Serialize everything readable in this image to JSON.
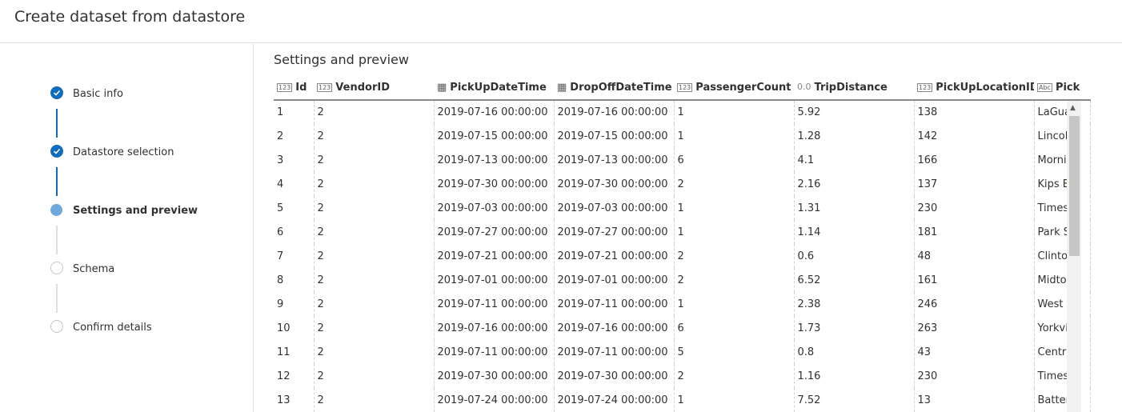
{
  "header": {
    "title": "Create dataset from datastore"
  },
  "steps": [
    {
      "label": "Basic info",
      "state": "done"
    },
    {
      "label": "Datastore selection",
      "state": "done"
    },
    {
      "label": "Settings and preview",
      "state": "current"
    },
    {
      "label": "Schema",
      "state": "todo"
    },
    {
      "label": "Confirm details",
      "state": "todo"
    }
  ],
  "main": {
    "title": "Settings and preview",
    "columns": [
      {
        "label": "Id",
        "type_icon": "123"
      },
      {
        "label": "VendorID",
        "type_icon": "123"
      },
      {
        "label": "PickUpDateTime",
        "type_icon": "calendar"
      },
      {
        "label": "DropOffDateTime",
        "type_icon": "calendar"
      },
      {
        "label": "PassengerCount",
        "type_icon": "123"
      },
      {
        "label": "TripDistance",
        "type_icon": "0.0"
      },
      {
        "label": "PickUpLocationID",
        "type_icon": "123"
      },
      {
        "label": "Pick",
        "type_icon": "Abc"
      }
    ],
    "rows": [
      [
        "1",
        "2",
        "2019-07-16 00:00:00",
        "2019-07-16 00:00:00",
        "1",
        "5.92",
        "138",
        "LaGua"
      ],
      [
        "2",
        "2",
        "2019-07-15 00:00:00",
        "2019-07-15 00:00:00",
        "1",
        "1.28",
        "142",
        "Lincol"
      ],
      [
        "3",
        "2",
        "2019-07-13 00:00:00",
        "2019-07-13 00:00:00",
        "6",
        "4.1",
        "166",
        "Morni"
      ],
      [
        "4",
        "2",
        "2019-07-30 00:00:00",
        "2019-07-30 00:00:00",
        "2",
        "2.16",
        "137",
        "Kips B"
      ],
      [
        "5",
        "2",
        "2019-07-03 00:00:00",
        "2019-07-03 00:00:00",
        "1",
        "1.31",
        "230",
        "Times"
      ],
      [
        "6",
        "2",
        "2019-07-27 00:00:00",
        "2019-07-27 00:00:00",
        "1",
        "1.14",
        "181",
        "Park S"
      ],
      [
        "7",
        "2",
        "2019-07-21 00:00:00",
        "2019-07-21 00:00:00",
        "2",
        "0.6",
        "48",
        "Clinto"
      ],
      [
        "8",
        "2",
        "2019-07-01 00:00:00",
        "2019-07-01 00:00:00",
        "2",
        "6.52",
        "161",
        "Midto"
      ],
      [
        "9",
        "2",
        "2019-07-11 00:00:00",
        "2019-07-11 00:00:00",
        "1",
        "2.38",
        "246",
        "West "
      ],
      [
        "10",
        "2",
        "2019-07-16 00:00:00",
        "2019-07-16 00:00:00",
        "6",
        "1.73",
        "263",
        "Yorkvi"
      ],
      [
        "11",
        "2",
        "2019-07-11 00:00:00",
        "2019-07-11 00:00:00",
        "5",
        "0.8",
        "43",
        "Centra"
      ],
      [
        "12",
        "2",
        "2019-07-30 00:00:00",
        "2019-07-30 00:00:00",
        "2",
        "1.16",
        "230",
        "Times"
      ],
      [
        "13",
        "2",
        "2019-07-24 00:00:00",
        "2019-07-24 00:00:00",
        "1",
        "7.52",
        "13",
        "Batter"
      ]
    ]
  },
  "colors": {
    "accent": "#0f6cbd",
    "current_step": "#6fa8dc",
    "border": "#e1dfdd"
  }
}
